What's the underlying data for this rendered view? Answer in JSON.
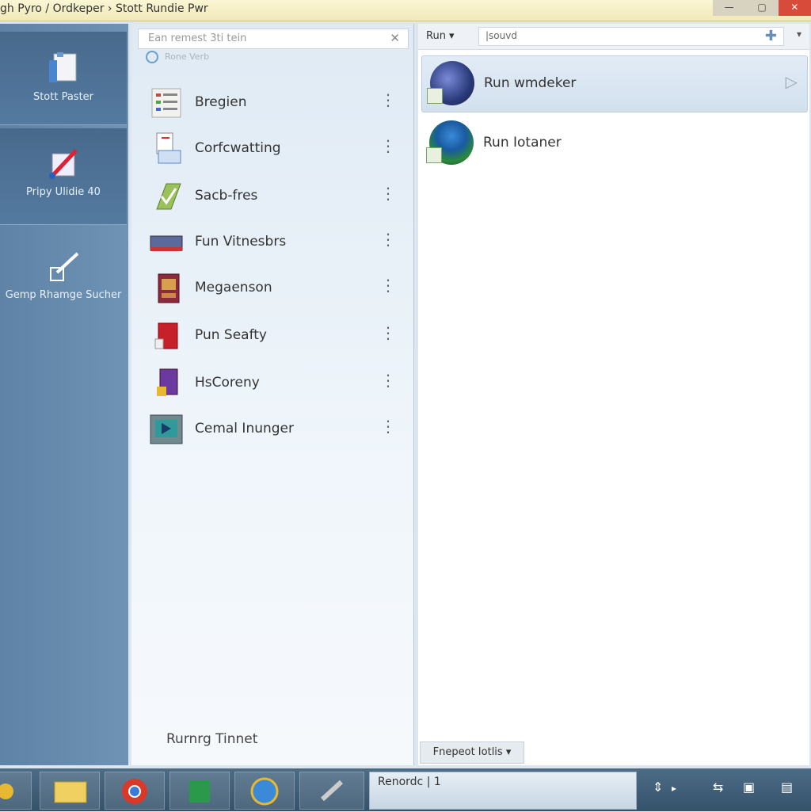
{
  "window": {
    "title": "gh Pyro / Ordkeper › Stott Rundie Pwr",
    "controls": {
      "minimize": "—",
      "maximize": "▢",
      "close": "✕"
    }
  },
  "sidebar": {
    "items": [
      {
        "label": "Stott Paster",
        "icon": "document-icon",
        "selected": true
      },
      {
        "label": "Pripy Ulidie 40",
        "icon": "edit-icon",
        "selected": true
      },
      {
        "label": "Gemp Rhamge Sucher",
        "icon": "brush-icon",
        "selected": false
      }
    ]
  },
  "middle": {
    "search_placeholder": "Ean remest 3ti tein",
    "clear_icon": "✕",
    "subheader": "Rone  Verb",
    "categories": [
      {
        "label": "Bregien",
        "icon": "list-icon"
      },
      {
        "label": "Corfcwatting",
        "icon": "form-icon"
      },
      {
        "label": "Sacb-fres",
        "icon": "check-icon"
      },
      {
        "label": "Fun Vitnesbrs",
        "icon": "keyboard-icon"
      },
      {
        "label": "Megaenson",
        "icon": "book-icon"
      },
      {
        "label": "Pun Seafty",
        "icon": "shield-icon"
      },
      {
        "label": "HsCoreny",
        "icon": "purple-box-icon"
      },
      {
        "label": "Cemal Inunger",
        "icon": "monitor-icon"
      }
    ],
    "row_menu_glyph": "⋮",
    "footer": "Rurnrg Tinnet"
  },
  "right": {
    "dropdown_label": "Run ▾",
    "input_value": "|souvd",
    "add_icon": "✚",
    "chevron": "▾",
    "items": [
      {
        "label": "Run wmdeker",
        "selected": true,
        "arrow": "▷"
      },
      {
        "label": "Run Iotaner",
        "selected": false,
        "arrow": ""
      }
    ],
    "status_button": "Fnepeot Iotlis ▾"
  },
  "taskbar": {
    "active_window": "Renordc | 1",
    "tray": {
      "arrows": "⇕",
      "chev": "▸",
      "net": "⇆",
      "win": "▣",
      "vol": "▤"
    }
  },
  "colors": {
    "sidebar": "#6285a8",
    "accent": "#4a7bb0",
    "titlebar": "#f6efc4",
    "taskbar": "#3f5e78",
    "close": "#d84a3a"
  }
}
